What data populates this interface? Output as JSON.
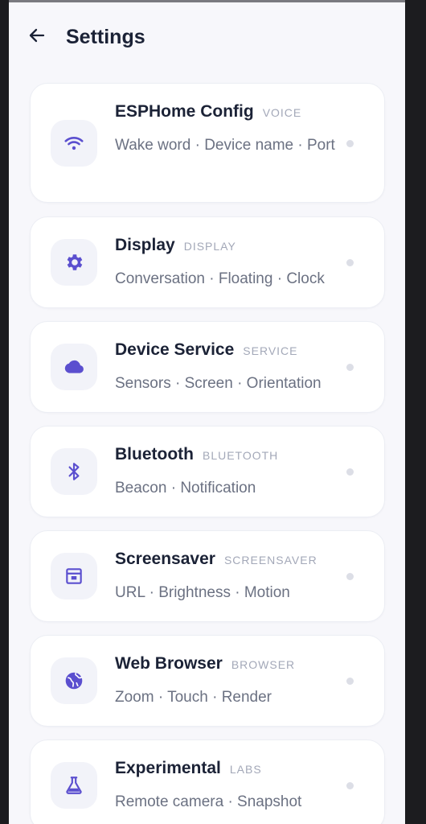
{
  "header": {
    "title": "Settings",
    "back_icon": "arrow-left-icon"
  },
  "accent_color": "#5b4fcf",
  "cards": [
    {
      "id": "esphome",
      "title": "ESPHome Config",
      "tag": "VOICE",
      "subtitle": "Wake word · Device name · Port",
      "icon": "wifi-icon"
    },
    {
      "id": "display",
      "title": "Display",
      "tag": "DISPLAY",
      "subtitle": "Conversation · Floating · Clock",
      "icon": "gear-icon"
    },
    {
      "id": "device-service",
      "title": "Device Service",
      "tag": "SERVICE",
      "subtitle": "Sensors · Screen · Orientation",
      "icon": "cloud-icon"
    },
    {
      "id": "bluetooth",
      "title": "Bluetooth",
      "tag": "BLUETOOTH",
      "subtitle": "Beacon · Notification",
      "icon": "bluetooth-icon"
    },
    {
      "id": "screensaver",
      "title": "Screensaver",
      "tag": "SCREENSAVER",
      "subtitle": "URL · Brightness · Motion",
      "icon": "screensaver-icon"
    },
    {
      "id": "web-browser",
      "title": "Web Browser",
      "tag": "BROWSER",
      "subtitle": "Zoom · Touch · Render",
      "icon": "globe-icon"
    },
    {
      "id": "experimental",
      "title": "Experimental",
      "tag": "LABS",
      "subtitle": "Remote camera · Snapshot",
      "icon": "flask-icon"
    }
  ]
}
